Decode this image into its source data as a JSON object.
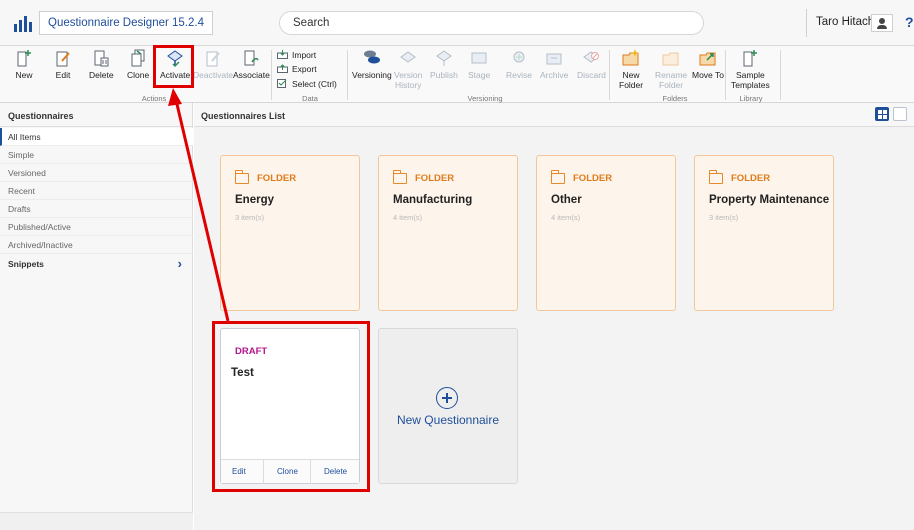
{
  "header": {
    "app_title": "Questionnaire Designer 15.2.4",
    "search_placeholder": "Search",
    "user_name": "Taro Hitachi",
    "help_glyph": "?"
  },
  "ribbon": {
    "actions": {
      "group_label": "Actions",
      "new": "New",
      "edit": "Edit",
      "delete": "Delete",
      "clone": "Clone",
      "activate": "Activate",
      "deactivate": "Deactivate",
      "associate": "Associate"
    },
    "data": {
      "group_label": "Data",
      "import": "Import",
      "export": "Export",
      "select": "Select (Ctrl)"
    },
    "versioning": {
      "group_label": "Versioning",
      "versioning": "Versioning",
      "version_history_1": "Version",
      "version_history_2": "History",
      "publish": "Publish",
      "stage": "Stage",
      "revise": "Revise",
      "archive": "Archive",
      "discard": "Discard"
    },
    "folders": {
      "group_label": "Folders",
      "new_folder_1": "New",
      "new_folder_2": "Folder",
      "rename_folder_1": "Rename",
      "rename_folder_2": "Folder",
      "move_to": "Move To"
    },
    "library": {
      "group_label": "Library",
      "sample_templates_1": "Sample",
      "sample_templates_2": "Templates"
    }
  },
  "sidebar": {
    "title": "Questionnaires",
    "items": [
      {
        "label": "All Items"
      },
      {
        "label": "Simple"
      },
      {
        "label": "Versioned"
      },
      {
        "label": "Recent"
      },
      {
        "label": "Drafts"
      },
      {
        "label": "Published/Active"
      },
      {
        "label": "Archived/Inactive"
      },
      {
        "label": "Snippets"
      }
    ],
    "snippets_arrow": "›"
  },
  "main": {
    "title": "Questionnaires List",
    "folders": [
      {
        "tag": "FOLDER",
        "name": "Energy",
        "count": "3 item(s)"
      },
      {
        "tag": "FOLDER",
        "name": "Manufacturing",
        "count": "4 item(s)"
      },
      {
        "tag": "FOLDER",
        "name": "Other",
        "count": "4 item(s)"
      },
      {
        "tag": "FOLDER",
        "name": "Property Maintenance",
        "count": "3 item(s)"
      }
    ],
    "draft": {
      "tag": "DRAFT",
      "name": "Test",
      "edit": "Edit",
      "clone": "Clone",
      "delete": "Delete"
    },
    "new_card_label": "New Questionnaire"
  },
  "colors": {
    "accent": "#1f4e9b",
    "folder_orange": "#e07b1a",
    "draft_magenta": "#b3168d",
    "annotation_red": "#e00000"
  }
}
